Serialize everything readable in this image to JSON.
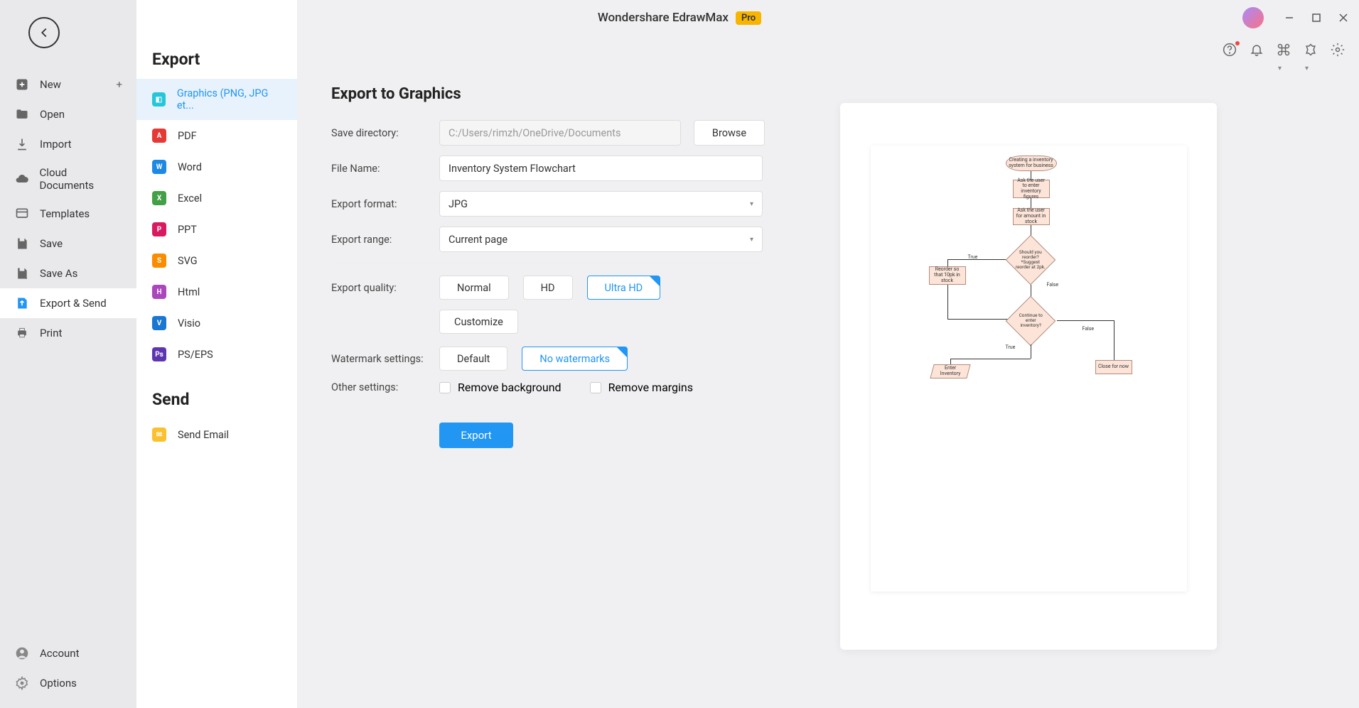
{
  "app": {
    "title": "Wondershare EdrawMax",
    "badge": "Pro"
  },
  "nav": {
    "new": "New",
    "open": "Open",
    "import": "Import",
    "cloud": "Cloud Documents",
    "templates": "Templates",
    "save": "Save",
    "saveas": "Save As",
    "exportsend": "Export & Send",
    "print": "Print",
    "account": "Account",
    "options": "Options"
  },
  "sub": {
    "export_heading": "Export",
    "graphics": "Graphics (PNG, JPG et...",
    "pdf": "PDF",
    "word": "Word",
    "excel": "Excel",
    "ppt": "PPT",
    "svg": "SVG",
    "html": "Html",
    "visio": "Visio",
    "pseps": "PS/EPS",
    "send_heading": "Send",
    "email": "Send Email"
  },
  "form": {
    "title": "Export to Graphics",
    "savedir_label": "Save directory:",
    "savedir_value": "C:/Users/rimzh/OneDrive/Documents",
    "browse": "Browse",
    "filename_label": "File Name:",
    "filename_value": "Inventory System Flowchart",
    "format_label": "Export format:",
    "format_value": "JPG",
    "range_label": "Export range:",
    "range_value": "Current page",
    "quality_label": "Export quality:",
    "quality_normal": "Normal",
    "quality_hd": "HD",
    "quality_uhd": "Ultra HD",
    "customize": "Customize",
    "watermark_label": "Watermark settings:",
    "watermark_default": "Default",
    "watermark_none": "No watermarks",
    "other_label": "Other settings:",
    "remove_bg": "Remove background",
    "remove_margins": "Remove margins",
    "export_btn": "Export"
  },
  "flowchart": {
    "n1": "Creating a inventory system for business",
    "n2": "Ask the user to enter inventory figures",
    "n3": "Ask the user for amount in stock",
    "n4": "Should you reorder? *Suggest reorder at 2pk.",
    "n5": "Reorder so that 10pk in stock",
    "n6": "Continue to enter inventory?",
    "n7": "Enter Inventory",
    "n8": "Close for now",
    "l_true": "True",
    "l_false": "False"
  }
}
